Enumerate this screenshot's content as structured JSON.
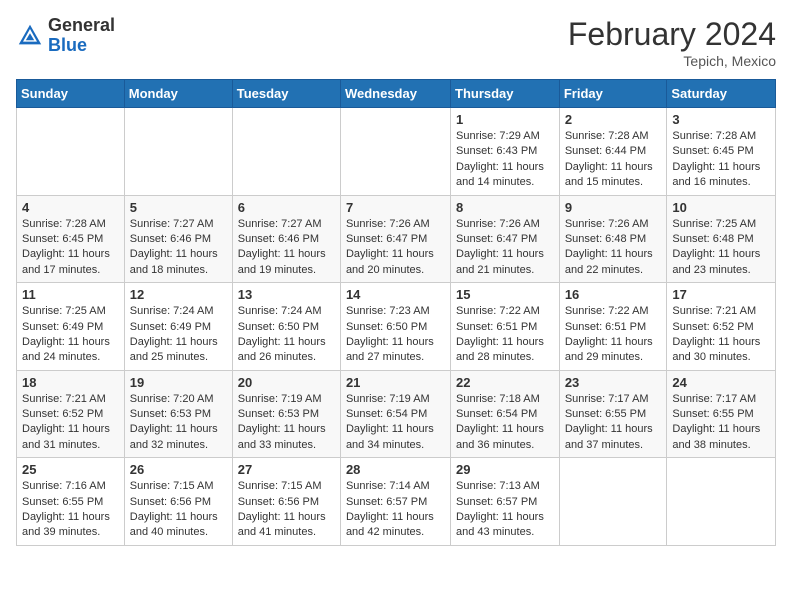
{
  "header": {
    "logo_general": "General",
    "logo_blue": "Blue",
    "month_year": "February 2024",
    "location": "Tepich, Mexico"
  },
  "days_of_week": [
    "Sunday",
    "Monday",
    "Tuesday",
    "Wednesday",
    "Thursday",
    "Friday",
    "Saturday"
  ],
  "weeks": [
    [
      {
        "day": "",
        "info": ""
      },
      {
        "day": "",
        "info": ""
      },
      {
        "day": "",
        "info": ""
      },
      {
        "day": "",
        "info": ""
      },
      {
        "day": "1",
        "info": "Sunrise: 7:29 AM\nSunset: 6:43 PM\nDaylight: 11 hours and 14 minutes."
      },
      {
        "day": "2",
        "info": "Sunrise: 7:28 AM\nSunset: 6:44 PM\nDaylight: 11 hours and 15 minutes."
      },
      {
        "day": "3",
        "info": "Sunrise: 7:28 AM\nSunset: 6:45 PM\nDaylight: 11 hours and 16 minutes."
      }
    ],
    [
      {
        "day": "4",
        "info": "Sunrise: 7:28 AM\nSunset: 6:45 PM\nDaylight: 11 hours and 17 minutes."
      },
      {
        "day": "5",
        "info": "Sunrise: 7:27 AM\nSunset: 6:46 PM\nDaylight: 11 hours and 18 minutes."
      },
      {
        "day": "6",
        "info": "Sunrise: 7:27 AM\nSunset: 6:46 PM\nDaylight: 11 hours and 19 minutes."
      },
      {
        "day": "7",
        "info": "Sunrise: 7:26 AM\nSunset: 6:47 PM\nDaylight: 11 hours and 20 minutes."
      },
      {
        "day": "8",
        "info": "Sunrise: 7:26 AM\nSunset: 6:47 PM\nDaylight: 11 hours and 21 minutes."
      },
      {
        "day": "9",
        "info": "Sunrise: 7:26 AM\nSunset: 6:48 PM\nDaylight: 11 hours and 22 minutes."
      },
      {
        "day": "10",
        "info": "Sunrise: 7:25 AM\nSunset: 6:48 PM\nDaylight: 11 hours and 23 minutes."
      }
    ],
    [
      {
        "day": "11",
        "info": "Sunrise: 7:25 AM\nSunset: 6:49 PM\nDaylight: 11 hours and 24 minutes."
      },
      {
        "day": "12",
        "info": "Sunrise: 7:24 AM\nSunset: 6:49 PM\nDaylight: 11 hours and 25 minutes."
      },
      {
        "day": "13",
        "info": "Sunrise: 7:24 AM\nSunset: 6:50 PM\nDaylight: 11 hours and 26 minutes."
      },
      {
        "day": "14",
        "info": "Sunrise: 7:23 AM\nSunset: 6:50 PM\nDaylight: 11 hours and 27 minutes."
      },
      {
        "day": "15",
        "info": "Sunrise: 7:22 AM\nSunset: 6:51 PM\nDaylight: 11 hours and 28 minutes."
      },
      {
        "day": "16",
        "info": "Sunrise: 7:22 AM\nSunset: 6:51 PM\nDaylight: 11 hours and 29 minutes."
      },
      {
        "day": "17",
        "info": "Sunrise: 7:21 AM\nSunset: 6:52 PM\nDaylight: 11 hours and 30 minutes."
      }
    ],
    [
      {
        "day": "18",
        "info": "Sunrise: 7:21 AM\nSunset: 6:52 PM\nDaylight: 11 hours and 31 minutes."
      },
      {
        "day": "19",
        "info": "Sunrise: 7:20 AM\nSunset: 6:53 PM\nDaylight: 11 hours and 32 minutes."
      },
      {
        "day": "20",
        "info": "Sunrise: 7:19 AM\nSunset: 6:53 PM\nDaylight: 11 hours and 33 minutes."
      },
      {
        "day": "21",
        "info": "Sunrise: 7:19 AM\nSunset: 6:54 PM\nDaylight: 11 hours and 34 minutes."
      },
      {
        "day": "22",
        "info": "Sunrise: 7:18 AM\nSunset: 6:54 PM\nDaylight: 11 hours and 36 minutes."
      },
      {
        "day": "23",
        "info": "Sunrise: 7:17 AM\nSunset: 6:55 PM\nDaylight: 11 hours and 37 minutes."
      },
      {
        "day": "24",
        "info": "Sunrise: 7:17 AM\nSunset: 6:55 PM\nDaylight: 11 hours and 38 minutes."
      }
    ],
    [
      {
        "day": "25",
        "info": "Sunrise: 7:16 AM\nSunset: 6:55 PM\nDaylight: 11 hours and 39 minutes."
      },
      {
        "day": "26",
        "info": "Sunrise: 7:15 AM\nSunset: 6:56 PM\nDaylight: 11 hours and 40 minutes."
      },
      {
        "day": "27",
        "info": "Sunrise: 7:15 AM\nSunset: 6:56 PM\nDaylight: 11 hours and 41 minutes."
      },
      {
        "day": "28",
        "info": "Sunrise: 7:14 AM\nSunset: 6:57 PM\nDaylight: 11 hours and 42 minutes."
      },
      {
        "day": "29",
        "info": "Sunrise: 7:13 AM\nSunset: 6:57 PM\nDaylight: 11 hours and 43 minutes."
      },
      {
        "day": "",
        "info": ""
      },
      {
        "day": "",
        "info": ""
      }
    ]
  ]
}
